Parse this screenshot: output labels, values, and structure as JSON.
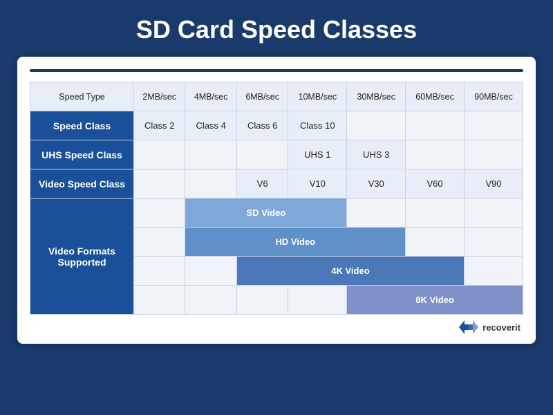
{
  "title": "SD Card Speed Classes",
  "card": {
    "header_line": true,
    "rows": {
      "speed_type": {
        "label": "Speed Type",
        "values": [
          "2MB/sec",
          "4MB/sec",
          "6MB/sec",
          "10MB/sec",
          "30MB/sec",
          "60MB/sec",
          "90MB/sec"
        ]
      },
      "speed_class": {
        "label": "Speed Class",
        "values": [
          "Class 2",
          "Class 4",
          "Class 6",
          "Class 10",
          "",
          "",
          ""
        ]
      },
      "uhs_speed_class": {
        "label": "UHS Speed Class",
        "values": [
          "",
          "",
          "",
          "UHS 1",
          "UHS 3",
          "",
          ""
        ]
      },
      "video_speed_class": {
        "label": "Video Speed Class",
        "values": [
          "",
          "",
          "V6",
          "V10",
          "V30",
          "V60",
          "V90"
        ]
      },
      "video_formats": {
        "label": "Video Formats\nSupported",
        "sd_label": "SD Video",
        "hd_label": "HD Video",
        "fk_label": "4K Video",
        "ek_label": "8K Video"
      }
    }
  },
  "branding": {
    "name": "recoverit"
  }
}
